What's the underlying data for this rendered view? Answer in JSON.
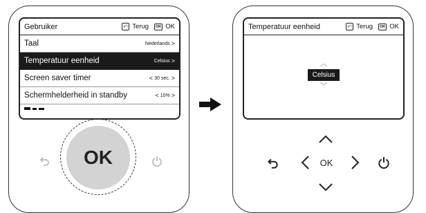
{
  "left_screen": {
    "title": "Gebruiker",
    "back_label": "Terug",
    "ok_icon_text": "OK",
    "ok_label": "OK",
    "items": [
      {
        "label": "Taal",
        "value": "Nederlands",
        "left_chev": "",
        "right_chev": ">"
      },
      {
        "label": "Temperatuur eenheid",
        "value": "Celsius",
        "left_chev": "",
        "right_chev": ">"
      },
      {
        "label": "Screen saver timer",
        "value": "30 sec.",
        "left_chev": "<",
        "right_chev": ">"
      },
      {
        "label": "Schermhelderheid in standby",
        "value": "10%",
        "left_chev": "<",
        "right_chev": ">"
      }
    ]
  },
  "left_controls": {
    "ok_button": "OK"
  },
  "right_screen": {
    "title": "Temperatuur eenheid",
    "back_label": "Terug",
    "ok_icon_text": "OK",
    "ok_label": "OK",
    "selected_unit": "Celsius"
  },
  "right_controls": {
    "ok_label": "OK"
  },
  "icons": {
    "back": "back-arrow-icon",
    "power": "power-icon",
    "transition": "right-arrow-icon"
  },
  "colors": {
    "selected_row_bg": "#1a1a1a",
    "ok_button_bg": "#d3d3d3"
  }
}
